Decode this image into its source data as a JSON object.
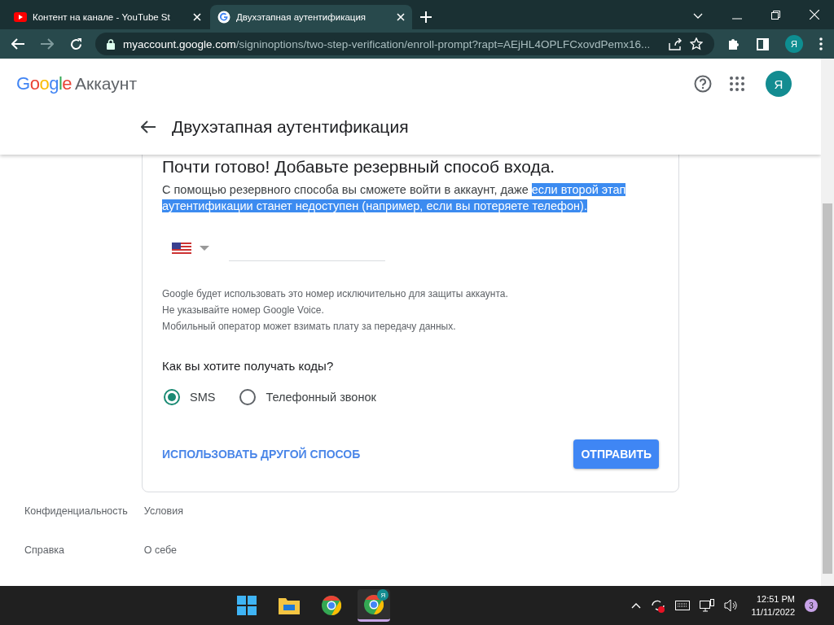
{
  "browser": {
    "tabs": [
      {
        "title": "Контент на канале - YouTube St",
        "kind": "video",
        "selected": false
      },
      {
        "title": "Двухэтапная аутентификация",
        "kind": "google",
        "selected": true
      }
    ],
    "url_host": "myaccount.google.com",
    "url_path": "/signinoptions/two-step-verification/enroll-prompt?rapt=AEjHL4OPLFCxovdPemx16...",
    "profile_initial": "Я"
  },
  "header": {
    "logo": "Google",
    "product": "Аккаунт",
    "avatar": "Я",
    "page_title": "Двухэтапная аутентификация"
  },
  "card": {
    "heading": "Почти готово! Добавьте резервный способ входа.",
    "description": "С помощью резервного способа вы сможете войти в аккаунт, даже",
    "selected_description": "если второй этап аутентификации станет недоступен (например, если вы потеряете телефон).",
    "notes": [
      "Google будет использовать это номер исключительно для защиты аккаунта.",
      "Не указывайте номер Google Voice.",
      "Мобильный оператор может взимать плату за передачу данных."
    ],
    "question": "Как вы хотите получать коды?",
    "options": [
      {
        "label": "SMS",
        "selected": true
      },
      {
        "label": "Телефонный звонок",
        "selected": false
      }
    ],
    "secondary_button": "ИСПОЛЬЗОВАТЬ ДРУГОЙ СПОСОБ",
    "primary_button": "ОТПРАВИТЬ"
  },
  "footer_links": [
    "Конфиденциальность",
    "Условия",
    "Справка",
    "О себе"
  ],
  "taskbar": {
    "apps": [
      {
        "kind": "start",
        "selected": false
      },
      {
        "kind": "explorer",
        "selected": false
      },
      {
        "kind": "chrome",
        "selected": false
      },
      {
        "kind": "chrome",
        "selected": true,
        "badge": "Я"
      }
    ],
    "time": "12:51 PM",
    "date": "11/11/2022",
    "notifications": "3"
  }
}
